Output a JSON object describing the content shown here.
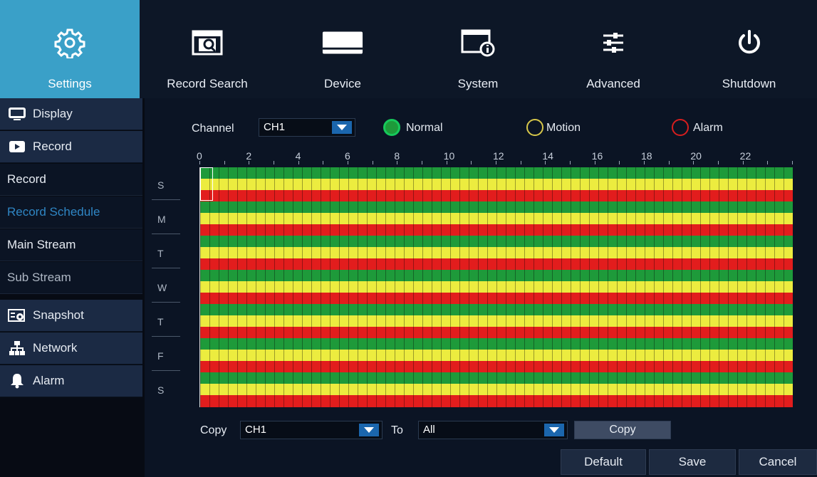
{
  "topbar": {
    "tabs": [
      {
        "label": "Settings",
        "icon": "gear-icon"
      },
      {
        "label": "Record Search",
        "icon": "film-search-icon"
      },
      {
        "label": "Device",
        "icon": "hard-drive-icon"
      },
      {
        "label": "System",
        "icon": "system-info-icon"
      },
      {
        "label": "Advanced",
        "icon": "sliders-icon"
      },
      {
        "label": "Shutdown",
        "icon": "power-icon"
      }
    ]
  },
  "sidebar": {
    "items": [
      {
        "label": "Display",
        "icon": "monitor-icon",
        "type": "group"
      },
      {
        "label": "Record",
        "icon": "record-icon",
        "type": "group"
      },
      {
        "label": "Record",
        "type": "sub"
      },
      {
        "label": "Record Schedule",
        "type": "sub",
        "selected": true
      },
      {
        "label": "Main Stream",
        "type": "sub"
      },
      {
        "label": "Sub Stream",
        "type": "sub"
      },
      {
        "label": "Snapshot",
        "icon": "snapshot-icon",
        "type": "group"
      },
      {
        "label": "Network",
        "icon": "network-icon",
        "type": "group"
      },
      {
        "label": "Alarm",
        "icon": "bell-icon",
        "type": "group"
      }
    ]
  },
  "schedule": {
    "channel_label": "Channel",
    "channel_value": "CH1",
    "legend": [
      {
        "label": "Normal",
        "color": "#1e9a3a",
        "filled": true
      },
      {
        "label": "Motion",
        "color": "#d8c84a",
        "filled": false
      },
      {
        "label": "Alarm",
        "color": "#d81e1e",
        "filled": false
      }
    ],
    "hour_labels": [
      "0",
      "2",
      "4",
      "6",
      "8",
      "10",
      "12",
      "14",
      "16",
      "18",
      "20",
      "22"
    ],
    "days": [
      "S",
      "M",
      "T",
      "W",
      "T",
      "F",
      "S"
    ],
    "colors": {
      "normal": "#1e9a3a",
      "motion": "#ecec3f",
      "alarm": "#e21d1d"
    }
  },
  "copy": {
    "copy_label": "Copy",
    "from_value": "CH1",
    "to_label": "To",
    "to_value": "All",
    "button_label": "Copy"
  },
  "footer": {
    "default_label": "Default",
    "save_label": "Save",
    "cancel_label": "Cancel"
  }
}
